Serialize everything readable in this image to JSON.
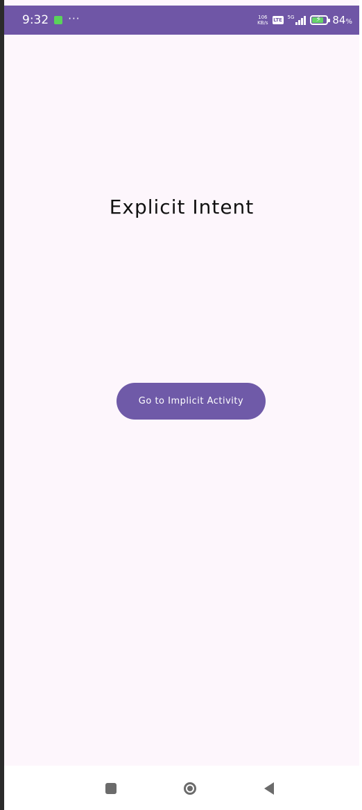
{
  "status_bar": {
    "time": "9:32",
    "speed_value": "106",
    "speed_unit": "KB/s",
    "lte_label": "LTE",
    "network_label": "5G",
    "battery_level": 84,
    "battery_text": "84",
    "battery_unit": "%",
    "background_color": "#6f56a6"
  },
  "main": {
    "title": "Explicit  Intent",
    "button_label": "Go to Implicit Activity",
    "button_color": "#6f5aa8",
    "background_color": "#fdf6fc"
  },
  "nav_bar": {
    "recent_icon": "square-icon",
    "home_icon": "circle-icon",
    "back_icon": "triangle-back-icon"
  }
}
